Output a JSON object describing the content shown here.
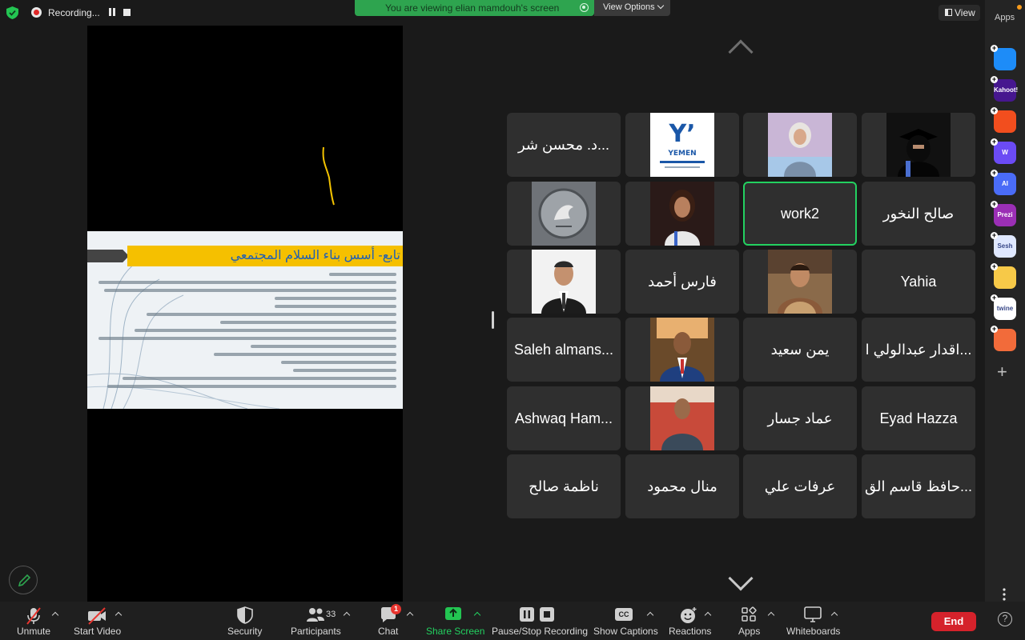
{
  "recording": {
    "label": "Recording..."
  },
  "banner": {
    "text": "You are viewing elian mamdouh's screen",
    "view_options": "View Options"
  },
  "slide": {
    "title": "تابع- أسس بناء السلام المجتمعي"
  },
  "view_button": {
    "label": "View"
  },
  "apps_sidebar": {
    "label": "Apps",
    "apps": [
      {
        "name": "app-1",
        "color": "#1d8cf8"
      },
      {
        "name": "kahoot",
        "color": "#46178f",
        "text": "Kahoot!"
      },
      {
        "name": "app-3",
        "color": "#f24e1e"
      },
      {
        "name": "app-4",
        "color": "#6b4bf5",
        "text": "W"
      },
      {
        "name": "app-5",
        "color": "#4a6cf7",
        "text": "AI"
      },
      {
        "name": "prezi",
        "color": "#9b2fb5",
        "text": "Prezi"
      },
      {
        "name": "sesh",
        "color": "#dfe8ff",
        "text": "Sesh"
      },
      {
        "name": "app-8",
        "color": "#f7c948"
      },
      {
        "name": "twine",
        "color": "#ffffff",
        "text": "twine"
      },
      {
        "name": "app-10",
        "color": "#f26b3a"
      }
    ]
  },
  "gallery": {
    "tiles": [
      {
        "name": "د. محسن شر...",
        "type": "name"
      },
      {
        "name": "yemen-logo",
        "type": "photo",
        "photo": "yemen"
      },
      {
        "name": "photo-woman-1",
        "type": "photo",
        "photo": "woman1"
      },
      {
        "name": "photo-woman-2",
        "type": "photo",
        "photo": "woman2"
      },
      {
        "name": "photo-emblem",
        "type": "photo",
        "photo": "emblem"
      },
      {
        "name": "photo-woman-3",
        "type": "photo",
        "photo": "woman3"
      },
      {
        "name": "work2",
        "type": "name",
        "active": true
      },
      {
        "name": "صالح النخور",
        "type": "name"
      },
      {
        "name": "photo-man-1",
        "type": "photo",
        "photo": "man1"
      },
      {
        "name": "فارس أحمد",
        "type": "name"
      },
      {
        "name": "photo-man-2",
        "type": "photo",
        "photo": "man2"
      },
      {
        "name": "Yahia",
        "type": "name"
      },
      {
        "name": "Saleh almans...",
        "type": "name"
      },
      {
        "name": "photo-man-3",
        "type": "photo",
        "photo": "man3"
      },
      {
        "name": "يمن سعيد",
        "type": "name"
      },
      {
        "name": "اقدار عبدالولي ا...",
        "type": "name"
      },
      {
        "name": "Ashwaq Ham...",
        "type": "name"
      },
      {
        "name": "photo-man-4",
        "type": "photo",
        "photo": "man4"
      },
      {
        "name": "عماد جسار",
        "type": "name"
      },
      {
        "name": "Eyad Hazza",
        "type": "name"
      },
      {
        "name": "ناظمة صالح",
        "type": "name"
      },
      {
        "name": "منال محمود",
        "type": "name"
      },
      {
        "name": "عرفات علي",
        "type": "name"
      },
      {
        "name": "حافظ قاسم الق...",
        "type": "name"
      }
    ]
  },
  "toolbar": {
    "unmute": "Unmute",
    "start_video": "Start Video",
    "security": "Security",
    "participants": "Participants",
    "participants_count": "33",
    "chat": "Chat",
    "chat_badge": "1",
    "share_screen": "Share Screen",
    "recording": "Pause/Stop Recording",
    "captions": "Show Captions",
    "captions_icon": "CC",
    "reactions": "Reactions",
    "apps": "Apps",
    "whiteboards": "Whiteboards",
    "end": "End"
  },
  "colors": {
    "accent_green": "#23d160",
    "end_red": "#d5222b",
    "banner_green": "#2ea44f"
  }
}
